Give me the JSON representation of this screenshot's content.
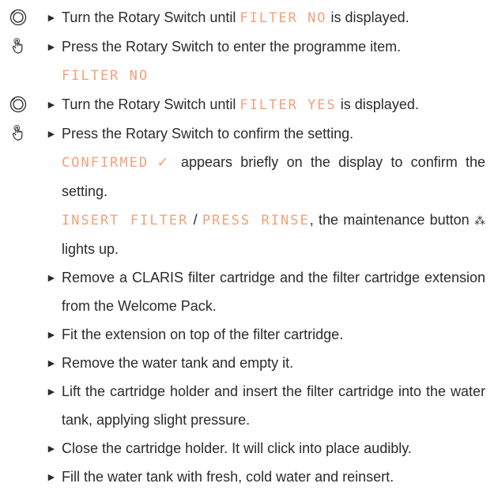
{
  "steps": [
    {
      "icon": "rotary-turn-icon",
      "pre": "Turn the Rotary Switch until ",
      "disp": "FILTER NO",
      "post": " is displayed."
    },
    {
      "icon": "rotary-press-icon",
      "text": "Press the Rotary Switch to enter the programme item."
    },
    {
      "display_line": "FILTER NO"
    },
    {
      "icon": "rotary-turn-icon",
      "pre": "Turn the Rotary Switch until ",
      "disp": "FILTER YES",
      "post": " is displayed."
    },
    {
      "icon": "rotary-press-icon",
      "text": "Press the Rotary Switch to confirm the setting."
    }
  ],
  "confirmed": {
    "disp": "CONFIRMED",
    "check": "✓",
    "text": " appears briefly on the display to confirm the setting."
  },
  "insert": {
    "disp1": "INSERT FILTER",
    "sep": " / ",
    "disp2": "PRESS RINSE",
    "text1": ", the maintenance button ",
    "maint_icon": "⁂",
    "text2": " lights up."
  },
  "bullets": [
    "Remove a CLARIS filter cartridge and the filter cartridge extension from the Welcome Pack.",
    "Fit the extension on top of the filter cartridge.",
    "Remove the water tank and empty it.",
    "Lift the cartridge holder and insert the filter cartridge into the water tank, applying slight pressure.",
    "Close the cartridge holder. It will click into place audibly.",
    "Fill the water tank with fresh, cold water and reinsert."
  ],
  "arrow": "►",
  "colors": {
    "display": "#f6a07a",
    "text": "#2b2b2b"
  }
}
